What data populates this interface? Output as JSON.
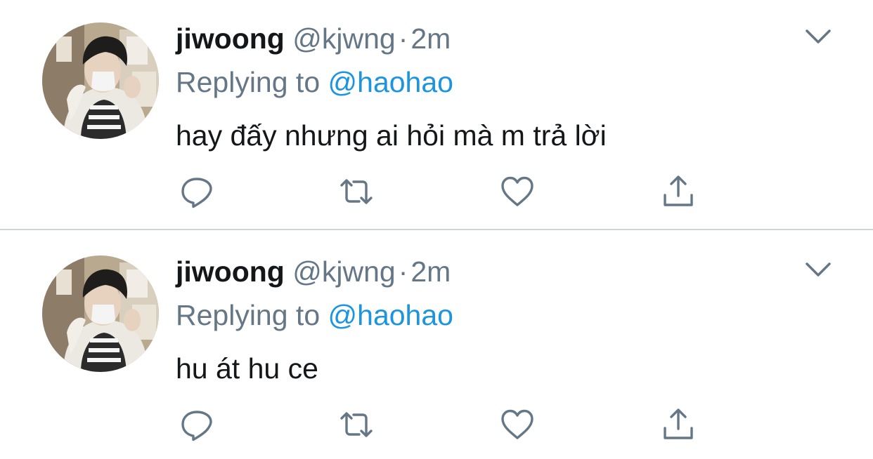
{
  "tweets": [
    {
      "name": "jiwoong",
      "handle": "@kjwng",
      "separator": "·",
      "time": "2m",
      "replying_prefix": "Replying to",
      "replying_to": "@haohao",
      "text": "hay đấy nhưng ai hỏi mà m trả lời",
      "icons": {
        "avatar": "avatar-photo",
        "menu": "chevron-down-icon",
        "reply": "reply-icon",
        "retweet": "retweet-icon",
        "like": "heart-icon",
        "share": "share-icon"
      }
    },
    {
      "name": "jiwoong",
      "handle": "@kjwng",
      "separator": "·",
      "time": "2m",
      "replying_prefix": "Replying to",
      "replying_to": "@haohao",
      "text": "hu át hu ce",
      "icons": {
        "avatar": "avatar-photo",
        "menu": "chevron-down-icon",
        "reply": "reply-icon",
        "retweet": "retweet-icon",
        "like": "heart-icon",
        "share": "share-icon"
      }
    }
  ],
  "colors": {
    "text_primary": "#14171a",
    "text_secondary": "#657786",
    "link": "#1b95e0",
    "icon": "#657786",
    "divider": "#cfd4d9"
  }
}
